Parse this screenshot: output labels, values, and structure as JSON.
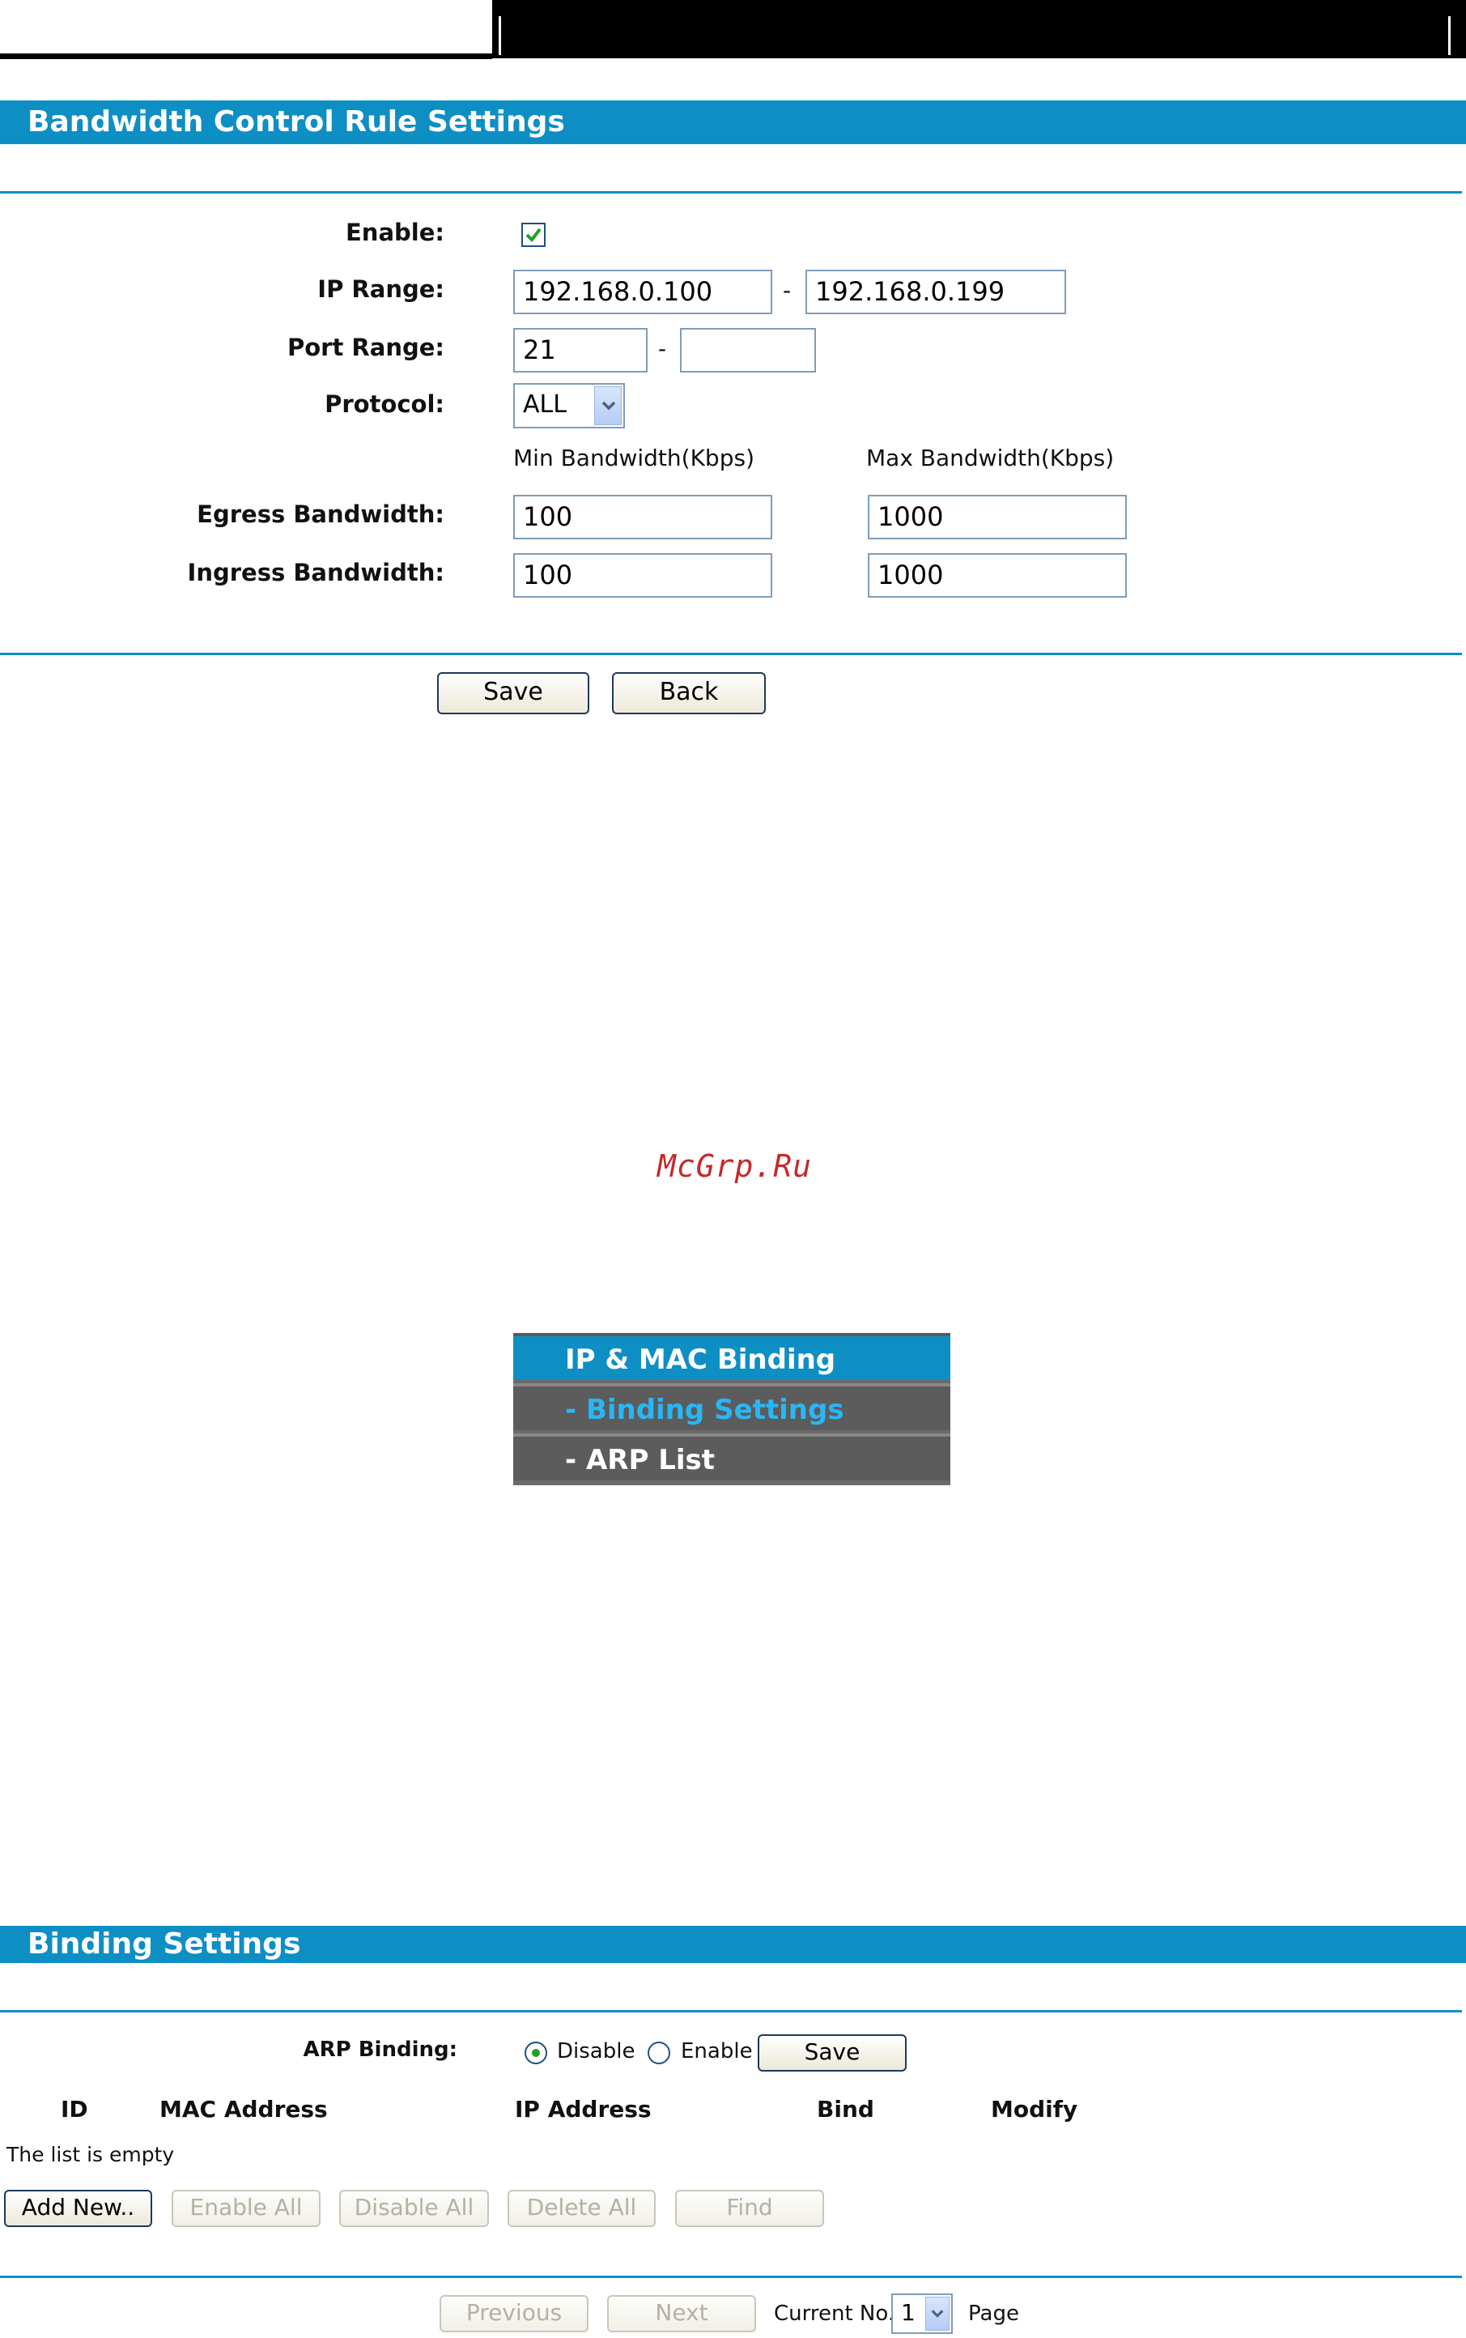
{
  "bandwidth": {
    "title": "Bandwidth Control Rule Settings",
    "enable_label": "Enable:",
    "enable_checked": true,
    "ip_range_label": "IP Range:",
    "ip_start": "192.168.0.100",
    "ip_end": "192.168.0.199",
    "port_range_label": "Port Range:",
    "port_start": "21",
    "port_end": "",
    "protocol_label": "Protocol:",
    "protocol_value": "ALL",
    "dash": "-",
    "min_header": "Min Bandwidth(Kbps)",
    "max_header": "Max Bandwidth(Kbps)",
    "egress_label": "Egress Bandwidth:",
    "egress_min": "100",
    "egress_max": "1000",
    "ingress_label": "Ingress Bandwidth:",
    "ingress_min": "100",
    "ingress_max": "1000",
    "save_label": "Save",
    "back_label": "Back"
  },
  "watermark": "McGrp.Ru",
  "menu": {
    "header": "IP & MAC Binding",
    "items": [
      {
        "label": "- Binding Settings",
        "active": true
      },
      {
        "label": "- ARP List",
        "active": false
      }
    ]
  },
  "binding": {
    "title": "Binding Settings",
    "arp_label": "ARP Binding:",
    "disable_label": "Disable",
    "enable_label": "Enable",
    "selected": "Disable",
    "save_label": "Save",
    "columns": [
      "ID",
      "MAC Address",
      "IP Address",
      "Bind",
      "Modify"
    ],
    "empty_text": "The list is empty",
    "add_new_label": "Add New..",
    "enable_all_label": "Enable All",
    "disable_all_label": "Disable All",
    "delete_all_label": "Delete All",
    "find_label": "Find",
    "previous_label": "Previous",
    "next_label": "Next",
    "current_no_label": "Current No.",
    "current_page": "1",
    "page_label": "Page"
  },
  "colors": {
    "accent": "#0e8fc4",
    "menu_gray": "#5c5c5c",
    "active_link": "#29b6f6"
  }
}
